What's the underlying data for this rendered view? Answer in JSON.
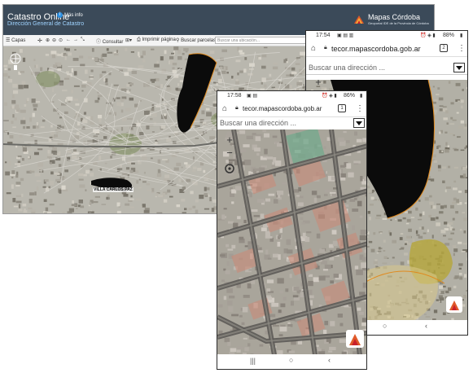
{
  "desktop": {
    "title": "Catastro Online",
    "info_label": "Más info",
    "subtitle": "Dirección General de Catastro",
    "logo": {
      "title": "Mapas Córdoba",
      "subtitle": "Geoportal IDE de la Provincia de Córdoba"
    },
    "toolbar": {
      "layers": "Capas",
      "consult": "Consultar",
      "print": "Imprimir página",
      "search_parcels": "Buscar parcelas",
      "search_placeholder": "Buscar una ubicación..."
    },
    "map_label": "VILLA CARLOS PAZ"
  },
  "phone_back": {
    "status_time": "17:54",
    "battery": "88%",
    "url": "tecor.mapascordoba.gob.ar",
    "tab_count": "2",
    "address_placeholder": "Buscar una dirección ..."
  },
  "phone_front": {
    "status_time": "17:58",
    "battery": "86%",
    "url": "tecor.mapascordoba.gob.ar",
    "tab_count": "1",
    "address_placeholder": "Buscar una dirección ..."
  },
  "colors": {
    "header": "#3b4a59",
    "lake": "#0b0b0b",
    "boundary": "#e08a1e",
    "parcel": "#c98a78",
    "green": "#6faa8c"
  }
}
